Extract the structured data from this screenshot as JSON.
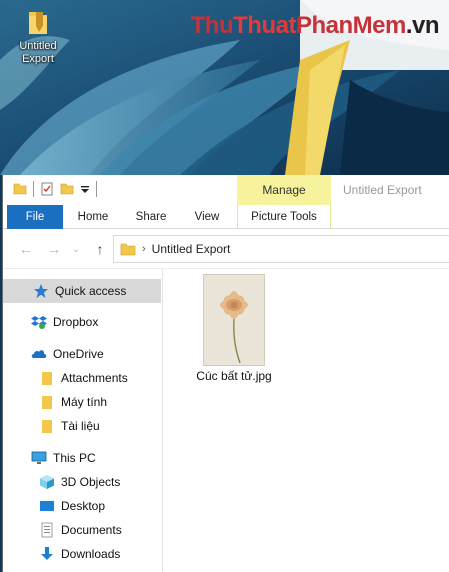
{
  "desktop": {
    "icon_label": "Untitled Export",
    "watermark": {
      "part1": "Thu",
      "part2": "Thuat",
      "part3": "PhanMem",
      "part4": ".vn"
    }
  },
  "window": {
    "title": "Untitled Export",
    "context_tab": "Manage",
    "ribbon_tabs": [
      "File",
      "Home",
      "Share",
      "View",
      "Picture Tools"
    ],
    "address": {
      "path": "Untitled Export"
    }
  },
  "nav_pane": {
    "items": [
      {
        "label": "Quick access",
        "icon": "star-icon",
        "selected": true
      },
      {
        "label": "Dropbox",
        "icon": "dropbox-icon"
      },
      {
        "label": "OneDrive",
        "icon": "cloud-icon"
      },
      {
        "label": "Attachments",
        "icon": "folder-icon"
      },
      {
        "label": "Máy tính",
        "icon": "folder-icon"
      },
      {
        "label": "Tài liệu",
        "icon": "folder-icon"
      },
      {
        "label": "This PC",
        "icon": "monitor-icon"
      },
      {
        "label": "3D Objects",
        "icon": "cube-icon"
      },
      {
        "label": "Desktop",
        "icon": "desktop-icon"
      },
      {
        "label": "Documents",
        "icon": "document-icon"
      },
      {
        "label": "Downloads",
        "icon": "download-arrow-icon"
      }
    ]
  },
  "files": [
    {
      "name": "Cúc bất tử.jpg",
      "icon": "image-thumbnail"
    }
  ],
  "colors": {
    "file_tab": "#1a6fc0",
    "manage_tab": "#f6f39c",
    "selected_nav": "#d9d9d9",
    "folder": "#f3c74a"
  }
}
